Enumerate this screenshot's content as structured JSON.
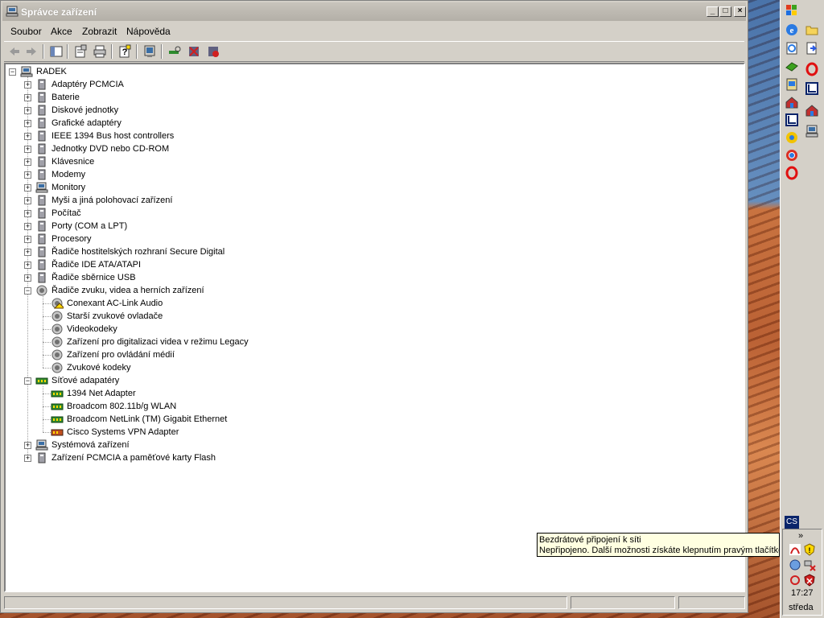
{
  "window": {
    "title": "Správce zařízení",
    "controls": {
      "minimize": "_",
      "maximize": "□",
      "close": "×"
    }
  },
  "menubar": {
    "items": [
      "Soubor",
      "Akce",
      "Zobrazit",
      "Nápověda"
    ]
  },
  "toolbar": {
    "buttons": [
      "back-icon",
      "forward-icon",
      "show-hide-tree-icon",
      "properties-icon",
      "print-icon",
      "help-icon",
      "monitor-icon",
      "scan-hardware-icon",
      "uninstall-icon",
      "disable-icon"
    ]
  },
  "tree": {
    "root": "RADEK",
    "categories": [
      "Adaptéry PCMCIA",
      "Baterie",
      "Diskové jednotky",
      "Grafické adaptéry",
      "IEEE 1394 Bus host controllers",
      "Jednotky DVD nebo CD-ROM",
      "Klávesnice",
      "Modemy",
      "Monitory",
      "Myši a jiná polohovací zařízení",
      "Počítač",
      "Porty (COM a LPT)",
      "Procesory",
      "Řadiče hostitelských rozhraní Secure Digital",
      "Řadiče IDE ATA/ATAPI",
      "Řadiče sběrnice USB",
      "Řadiče zvuku, videa a herních zařízení"
    ],
    "sound_children": [
      "Conexant AC-Link Audio",
      "Starší zvukové ovladače",
      "Videokodeky",
      "Zařízení pro digitalizaci videa v režimu Legacy",
      "Zařízení pro ovládání médií",
      "Zvukové kodeky"
    ],
    "network_category": "Síťové adapatéry",
    "network_children": [
      "1394 Net Adapter",
      "Broadcom 802.11b/g WLAN",
      "Broadcom NetLink (TM) Gigabit Ethernet",
      "Cisco Systems VPN Adapter"
    ],
    "tail_categories": [
      "Systémová zařízení",
      "Zařízení PCMCIA a paměťové karty Flash"
    ]
  },
  "tray": {
    "language": "CS",
    "expand": "»",
    "clock": "17:27",
    "day": "středa"
  },
  "tooltip": {
    "title": "Bezdrátové připojení k síti",
    "text": "Nepřipojeno. Další možnosti získáte klepnutím pravým tlačítkem"
  },
  "colors": {
    "chrome": "#d4d0c8",
    "tooltip_bg": "#ffffe1",
    "warning": "#ffd800"
  }
}
